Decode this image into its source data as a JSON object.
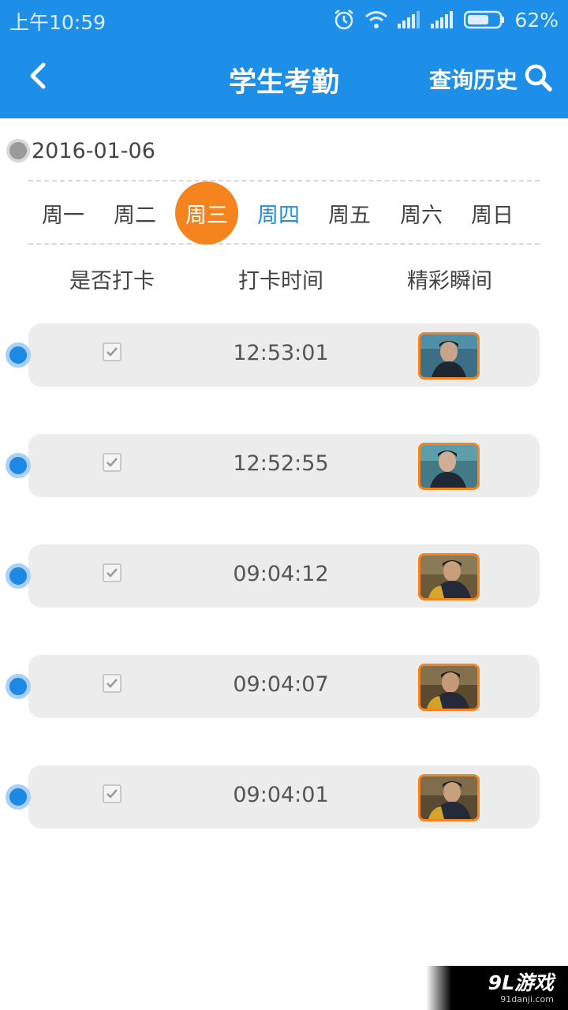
{
  "status_bar": {
    "time": "上午10:59",
    "battery": "62%",
    "icons": [
      "alarm-icon",
      "wifi-icon",
      "signal-icon",
      "signal-icon",
      "battery-icon"
    ]
  },
  "header": {
    "title": "学生考勤",
    "history_label": "查询历史",
    "back_icon": "chevron-left-icon",
    "search_icon": "search-icon",
    "color": "#1e8fe8"
  },
  "date": "2016-01-06",
  "week": {
    "days": [
      "周一",
      "周二",
      "周三",
      "周四",
      "周五",
      "周六",
      "周日"
    ],
    "selected_index": 2,
    "today_index": 3,
    "selected_color": "#f5841f"
  },
  "columns": {
    "checked": "是否打卡",
    "time": "打卡时间",
    "photo": "精彩瞬间"
  },
  "records": [
    {
      "checked": true,
      "time": "12:53:01",
      "photo_icon": "photo-thumbnail"
    },
    {
      "checked": true,
      "time": "12:52:55",
      "photo_icon": "photo-thumbnail"
    },
    {
      "checked": true,
      "time": "09:04:12",
      "photo_icon": "photo-thumbnail"
    },
    {
      "checked": true,
      "time": "09:04:07",
      "photo_icon": "photo-thumbnail"
    },
    {
      "checked": true,
      "time": "09:04:01",
      "photo_icon": "photo-thumbnail"
    }
  ],
  "watermark": {
    "main": "9L游戏",
    "sub": "91danji.com"
  }
}
